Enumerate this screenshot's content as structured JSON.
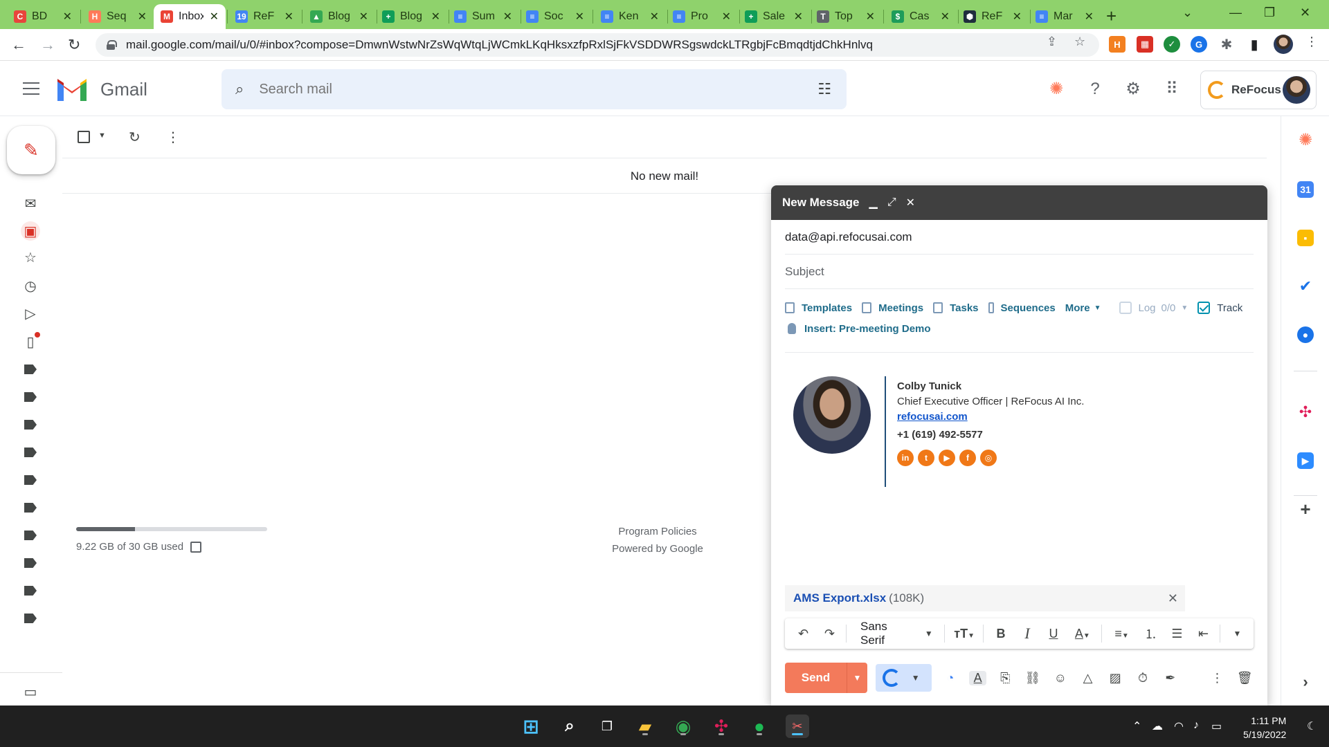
{
  "browser": {
    "tabs": [
      {
        "label": "BD",
        "favicon": "C",
        "color": "#e8453c"
      },
      {
        "label": "Seq",
        "favicon": "H",
        "color": "#ff7a59"
      },
      {
        "label": "Inbox",
        "favicon": "M",
        "color": "#ea4335",
        "active": true
      },
      {
        "label": "ReF",
        "favicon": "19",
        "color": "#4285f4"
      },
      {
        "label": "Blog",
        "favicon": "▲",
        "color": "#34a853"
      },
      {
        "label": "Blog",
        "favicon": "+",
        "color": "#0f9d58"
      },
      {
        "label": "Sum",
        "favicon": "≡",
        "color": "#4285f4"
      },
      {
        "label": "Soc",
        "favicon": "≡",
        "color": "#4285f4"
      },
      {
        "label": "Ken",
        "favicon": "≡",
        "color": "#4285f4"
      },
      {
        "label": "Pro",
        "favicon": "≡",
        "color": "#4285f4"
      },
      {
        "label": "Sale",
        "favicon": "+",
        "color": "#0f9d58"
      },
      {
        "label": "Top",
        "favicon": "T",
        "color": "#5f6368"
      },
      {
        "label": "Cas",
        "favicon": "$",
        "color": "#1e9c5a"
      },
      {
        "label": "ReF",
        "favicon": "⬢",
        "color": "#1f2d3d"
      },
      {
        "label": "Mar",
        "favicon": "≡",
        "color": "#4285f4"
      }
    ],
    "url": "mail.google.com/mail/u/0/#inbox?compose=DmwnWstwNrZsWqWtqLjWCmkLKqHksxzfpRxlSjFkVSDDWRSgswdckLTRgbjFcBmqdtjdChkHnlvq"
  },
  "gmail": {
    "app_name": "Gmail",
    "search_placeholder": "Search mail",
    "refocus_label": "ReFocus",
    "empty_state": "No new mail!",
    "storage_text": "9.22 GB of 30 GB used",
    "storage_fraction": 0.307,
    "footer": {
      "policies": "Program Policies",
      "powered": "Powered by Google"
    }
  },
  "compose": {
    "title": "New Message",
    "to": "data@api.refocusai.com",
    "subject_placeholder": "Subject",
    "hubspot": {
      "templates": "Templates",
      "meetings": "Meetings",
      "tasks": "Tasks",
      "sequences": "Sequences",
      "more": "More",
      "log": "Log",
      "log_count": "0/0",
      "track": "Track",
      "insert": "Insert: Pre-meeting Demo"
    },
    "signature": {
      "name": "Colby Tunick",
      "role": "Chief Executive Officer | ReFocus AI Inc.",
      "site": "refocusai.com",
      "phone": "+1 (619) 492-5577"
    },
    "attachment": {
      "name": "AMS Export.xlsx",
      "size": "(108K)"
    },
    "font": "Sans Serif",
    "send_label": "Send"
  },
  "taskbar": {
    "time": "1:11 PM",
    "date": "5/19/2022"
  }
}
